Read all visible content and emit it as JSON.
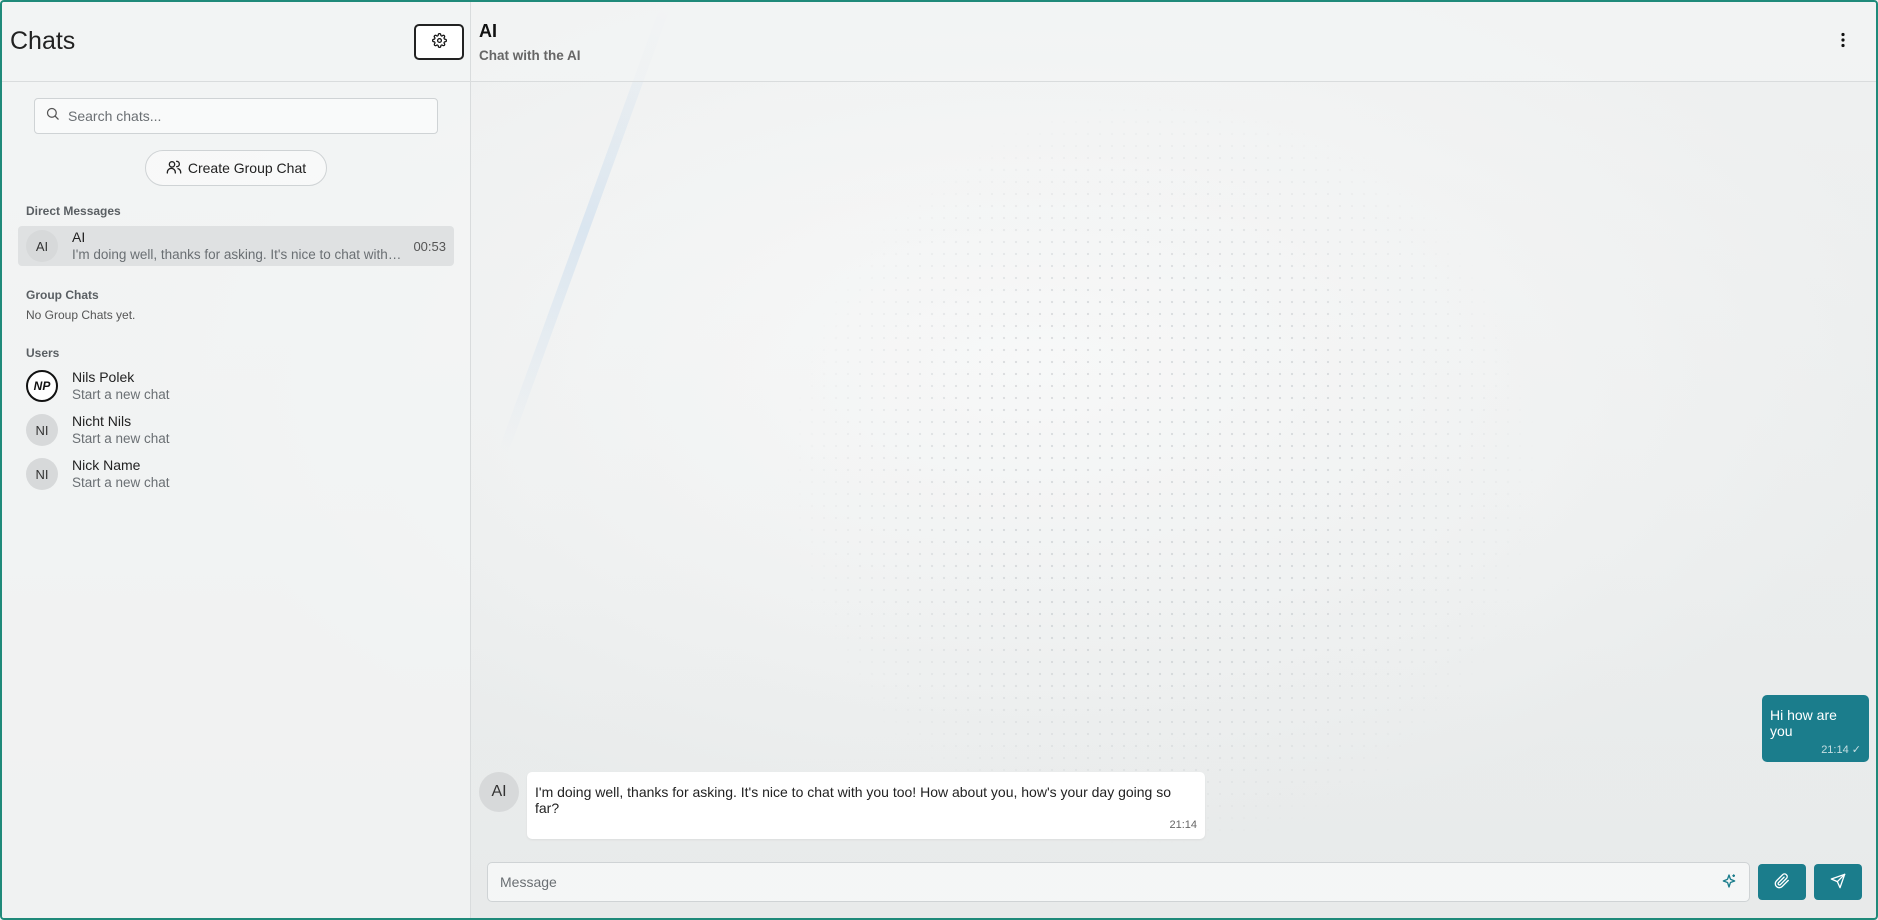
{
  "sidebar": {
    "title": "Chats",
    "search_placeholder": "Search chats...",
    "create_group_label": "Create Group Chat",
    "direct_messages_label": "Direct Messages",
    "direct_messages": [
      {
        "avatar": "AI",
        "name": "AI",
        "preview": "I'm doing well, thanks for asking. It's nice to chat with you too! How about you, how's your day going so far?",
        "time": "00:53"
      }
    ],
    "group_chats_label": "Group Chats",
    "group_chats_empty": "No Group Chats yet.",
    "users_label": "Users",
    "users": [
      {
        "avatar": "NP",
        "name": "Nils Polek",
        "subtitle": "Start a new chat"
      },
      {
        "avatar": "NI",
        "name": "Nicht Nils",
        "subtitle": "Start a new chat"
      },
      {
        "avatar": "NI",
        "name": "Nick Name",
        "subtitle": "Start a new chat"
      }
    ]
  },
  "main": {
    "title": "AI",
    "subtitle": "Chat with the AI"
  },
  "messages": [
    {
      "direction": "out",
      "text": "Hi how are you",
      "time": "21:14",
      "status": "✓"
    },
    {
      "direction": "in",
      "avatar": "AI",
      "text": "I'm doing well, thanks for asking. It's nice to chat with you too! How about you, how's your day going so far?",
      "time": "21:14"
    }
  ],
  "composer": {
    "placeholder": "Message"
  },
  "icons": {
    "settings": "gear-icon",
    "search": "search-icon",
    "group": "users-icon",
    "menu": "kebab-menu-icon",
    "sparkle": "sparkle-icon",
    "attach": "paperclip-icon",
    "send": "send-icon"
  },
  "colors": {
    "accent": "#1b7d8c",
    "border_frame": "#1f8a7a",
    "active_item": "#dfe1e2"
  }
}
